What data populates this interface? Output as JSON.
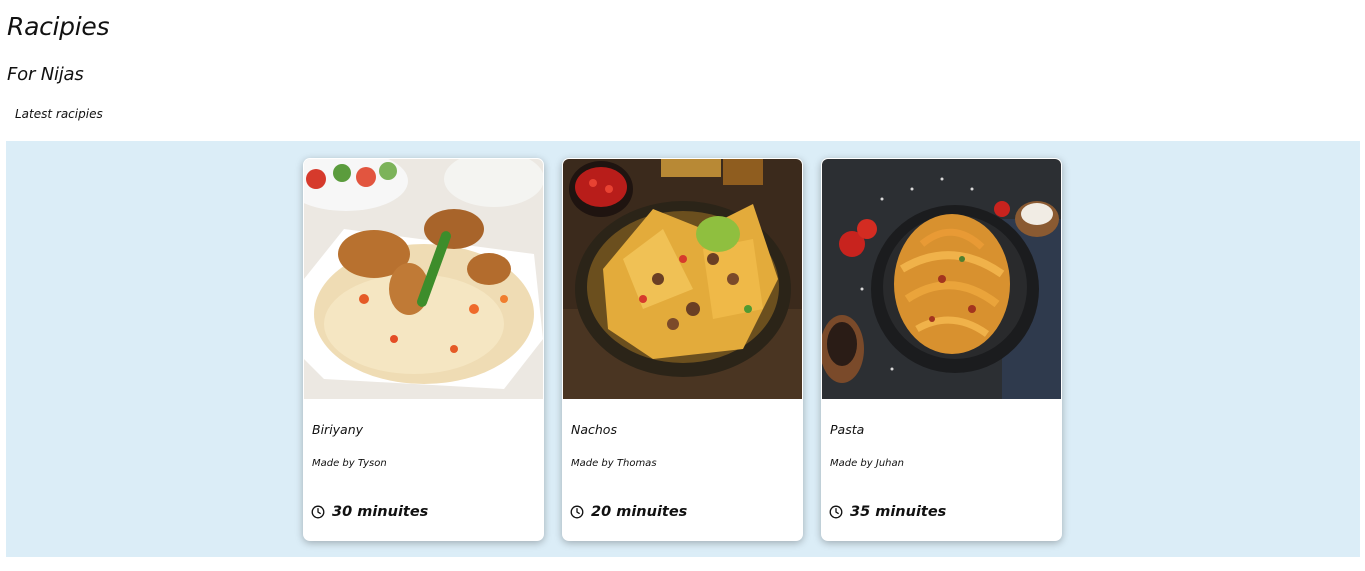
{
  "header": {
    "title": "Racipies",
    "subtitle": "For Nijas",
    "section_label": "Latest racipies"
  },
  "recipes": [
    {
      "name": "Biriyany",
      "author": "Made by Tyson",
      "time": "30 minuites",
      "image_icon": "biriyani-photo"
    },
    {
      "name": "Nachos",
      "author": "Made by Thomas",
      "time": "20 minuites",
      "image_icon": "nachos-photo"
    },
    {
      "name": "Pasta",
      "author": "Made by Juhan",
      "time": "35 minuites",
      "image_icon": "pasta-photo"
    }
  ],
  "colors": {
    "band_background": "#dbedf7",
    "card_background": "#ffffff",
    "text": "#111111"
  },
  "icons": {
    "time": "clock-icon"
  }
}
